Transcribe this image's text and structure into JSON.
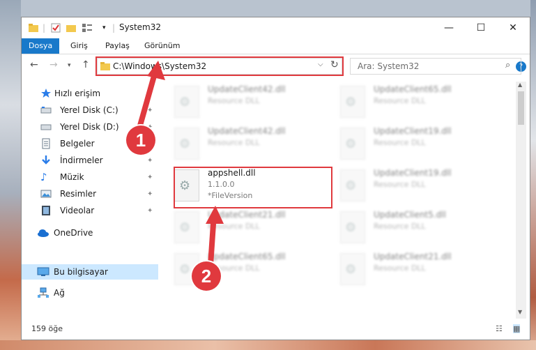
{
  "window": {
    "title": "System32"
  },
  "ribbon": {
    "tabs": [
      "Dosya",
      "Giriş",
      "Paylaş",
      "Görünüm"
    ]
  },
  "address": {
    "path": "C:\\Windows\\System32"
  },
  "search": {
    "placeholder": "Ara: System32"
  },
  "sidebar": {
    "items": [
      {
        "label": "Hızlı erişim",
        "icon": "star-icon",
        "pinned": false
      },
      {
        "label": "Yerel Disk (C:)",
        "icon": "drive-icon",
        "pinned": true
      },
      {
        "label": "Yerel Disk (D:)",
        "icon": "drive-icon",
        "pinned": true
      },
      {
        "label": "Belgeler",
        "icon": "document-icon",
        "pinned": true
      },
      {
        "label": "İndirmeler",
        "icon": "download-icon",
        "pinned": true
      },
      {
        "label": "Müzik",
        "icon": "music-icon",
        "pinned": true
      },
      {
        "label": "Resimler",
        "icon": "pictures-icon",
        "pinned": true
      },
      {
        "label": "Videolar",
        "icon": "video-icon",
        "pinned": true
      },
      {
        "label": "OneDrive",
        "icon": "cloud-icon",
        "pinned": false
      },
      {
        "label": "Bu bilgisayar",
        "icon": "computer-icon",
        "pinned": false
      },
      {
        "label": "Ağ",
        "icon": "network-icon",
        "pinned": false
      }
    ]
  },
  "files": [
    {
      "name": "UpdateClient42.dll",
      "line1": "Resource DLL",
      "line2": ""
    },
    {
      "name": "UpdateClient65.dll",
      "line1": "Resource DLL",
      "line2": ""
    },
    {
      "name": "UpdateClient42.dll",
      "line1": "Resource DLL",
      "line2": ""
    },
    {
      "name": "UpdateClient19.dll",
      "line1": "Resource DLL",
      "line2": ""
    },
    {
      "name": "appshell.dll",
      "line1": "1.1.0.0",
      "line2": "*FileVersion"
    },
    {
      "name": "UpdateClient19.dll",
      "line1": "Resource DLL",
      "line2": ""
    },
    {
      "name": "UpdateClient21.dll",
      "line1": "Resource DLL",
      "line2": ""
    },
    {
      "name": "UpdateClient5.dll",
      "line1": "Resource DLL",
      "line2": ""
    },
    {
      "name": "UpdateClient65.dll",
      "line1": "Resource DLL",
      "line2": ""
    },
    {
      "name": "UpdateClient21.dll",
      "line1": "Resource DLL",
      "line2": ""
    }
  ],
  "status": {
    "count": "159 öğe"
  },
  "badges": {
    "one": "1",
    "two": "2"
  },
  "colors": {
    "accent": "#1979ca",
    "highlight": "#e0393e",
    "selected": "#cce8ff"
  }
}
